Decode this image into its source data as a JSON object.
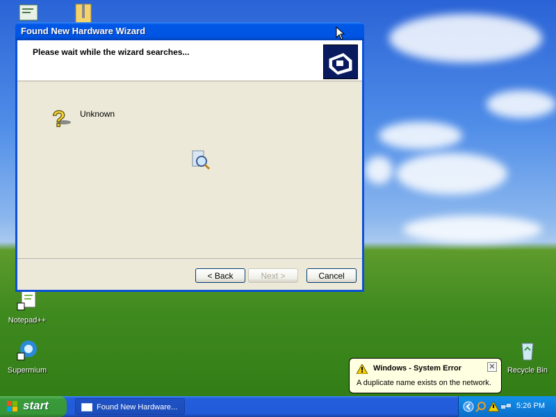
{
  "desktop": {
    "icons": [
      {
        "label": "Notepad++"
      },
      {
        "label": "Supermium"
      },
      {
        "label": "Recycle Bin"
      }
    ]
  },
  "window": {
    "title": "Found New Hardware Wizard",
    "header_message": "Please wait while the wizard searches...",
    "device_label": "Unknown",
    "buttons": {
      "back": "< Back",
      "next": "Next >",
      "cancel": "Cancel"
    }
  },
  "taskbar": {
    "start_label": "start",
    "task_button_label": "Found New Hardware...",
    "clock": "5:26 PM"
  },
  "balloon": {
    "title": "Windows - System Error",
    "message": "A duplicate name exists on the network.",
    "close_label": "✕"
  },
  "icons": {
    "device": "question-mark-device-icon",
    "search": "magnifier-search-icon",
    "warning": "warning-triangle-icon"
  },
  "colors": {
    "titlebar": "#0054e3",
    "taskbar": "#245edc",
    "start_button": "#3a9a3a",
    "balloon": "#ffffe1"
  }
}
